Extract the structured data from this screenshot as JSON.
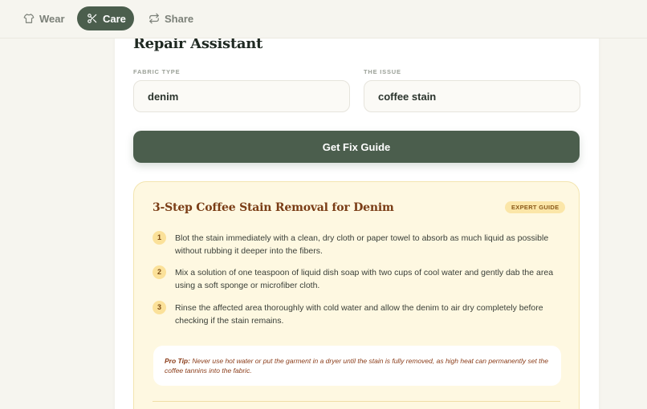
{
  "nav": {
    "tabs": [
      {
        "label": "Wear",
        "icon": "shirt-icon",
        "active": false
      },
      {
        "label": "Care",
        "icon": "scissors-icon",
        "active": true
      },
      {
        "label": "Share",
        "icon": "swap-icon",
        "active": false
      }
    ]
  },
  "assistant": {
    "title": "Repair Assistant",
    "fabric_label": "FABRIC TYPE",
    "fabric_value": "denim",
    "issue_label": "THE ISSUE",
    "issue_value": "coffee stain",
    "submit_label": "Get Fix Guide"
  },
  "guide": {
    "title": "3-Step Coffee Stain Removal for Denim",
    "badge": "EXPERT GUIDE",
    "steps": [
      {
        "num": "1",
        "text": "Blot the stain immediately with a clean, dry cloth or paper towel to absorb as much liquid as possible without rubbing it deeper into the fibers."
      },
      {
        "num": "2",
        "text": "Mix a solution of one teaspoon of liquid dish soap with two cups of cool water and gently dab the area using a soft sponge or microfiber cloth."
      },
      {
        "num": "3",
        "text": "Rinse the affected area thoroughly with cold water and allow the denim to air dry completely before checking if the stain remains."
      }
    ],
    "tip_label": "Pro Tip:",
    "tip_text": "Never use hot water or put the garment in a dryer until the stain is fully removed, as high heat can permanently set the coffee tannins into the fabric."
  },
  "colors": {
    "accent": "#4b5e4d",
    "guide_bg": "#fef8e1",
    "guide_title": "#7a3d16",
    "page_bg": "#f6f5ef"
  }
}
